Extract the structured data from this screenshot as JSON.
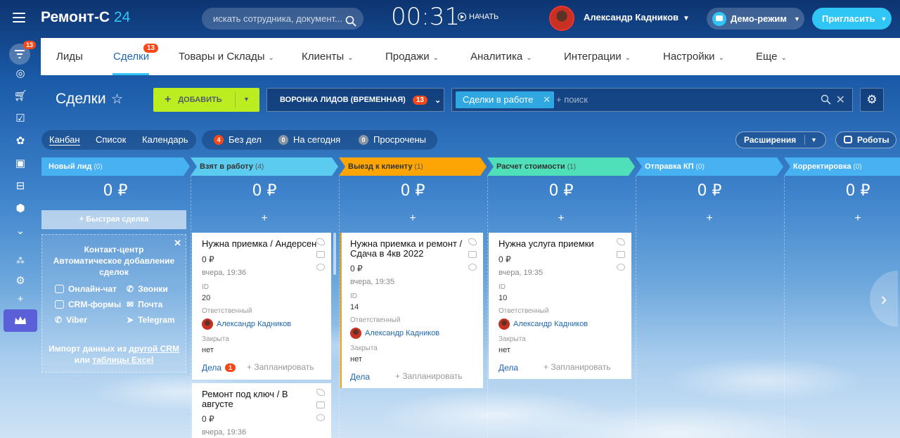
{
  "app": {
    "logo_main": "Ремонт-С",
    "logo_num": "24",
    "search_placeholder": "искать сотрудника, документ...",
    "clock": "00:31",
    "start": "НАЧАТЬ",
    "user": "Александр Кадников",
    "demo": "Демо-режим",
    "invite": "Пригласить",
    "rail_badge": "13"
  },
  "nav": {
    "items": [
      {
        "label": "Лиды",
        "dd": ""
      },
      {
        "label": "Сделки",
        "dd": ""
      },
      {
        "label": "Товары и Склады",
        "dd": "⌄"
      },
      {
        "label": "Клиенты",
        "dd": "⌄"
      },
      {
        "label": "Продажи",
        "dd": "⌄"
      },
      {
        "label": "Аналитика",
        "dd": "⌄"
      },
      {
        "label": "Интеграции",
        "dd": "⌄"
      },
      {
        "label": "Настройки",
        "dd": "⌄"
      },
      {
        "label": "Еще",
        "dd": "⌄"
      }
    ],
    "deals_badge": "13"
  },
  "toolbar": {
    "title": "Сделки",
    "add": "ДОБАВИТЬ",
    "funnel": "ВОРОНКА ЛИДОВ (ВРЕМЕННАЯ)",
    "funnel_badge": "13",
    "filter_tag": "Сделки в работе",
    "filter_placeholder": "+ поиск"
  },
  "views": {
    "kanban": "Канбан",
    "list": "Список",
    "calendar": "Календарь"
  },
  "counters": [
    {
      "n": "4",
      "label": "Без дел",
      "color": "#f54819"
    },
    {
      "n": "0",
      "label": "На сегодня",
      "color": "#7c8592"
    },
    {
      "n": "0",
      "label": "Просрочены",
      "color": "#7c8592"
    }
  ],
  "extensions": "Расширения",
  "robots": "Роботы",
  "columns": [
    {
      "name": "Новый лид",
      "count": "(0)",
      "sum": "0 ₽",
      "color": "#47b1f2"
    },
    {
      "name": "Взят в работу",
      "count": "(4)",
      "sum": "0 ₽",
      "color": "#5bcbef"
    },
    {
      "name": "Выезд к клиенту",
      "count": "(1)",
      "sum": "0 ₽",
      "color": "#fda505"
    },
    {
      "name": "Расчет стоимости",
      "count": "(1)",
      "sum": "0 ₽",
      "color": "#4fe0b9"
    },
    {
      "name": "Отправка КП",
      "count": "(0)",
      "sum": "0 ₽",
      "color": "#47b1f2"
    },
    {
      "name": "Корректировка",
      "count": "(0)",
      "sum": "0 ₽",
      "color": "#47b1f2"
    }
  ],
  "quick_deal": "Быстрая сделка",
  "contact_center": {
    "title": "Контакт-центр Автоматическое добавление сделок",
    "channels": [
      "Онлайн-чат",
      "Звонки",
      "CRM-формы",
      "Почта",
      "Viber",
      "Telegram"
    ],
    "import_prefix": "Импорт данных из",
    "import_link1": "другой CRM",
    "import_or": "или",
    "import_link2": "таблицы Excel"
  },
  "card_labels": {
    "id": "ID",
    "resp": "Ответственный",
    "closed": "Закрыта",
    "deals": "Дела",
    "plan": "+ Запланировать"
  },
  "cards": [
    {
      "title": "Нужна приемка / Андерсен",
      "sum": "0 ₽",
      "date": "вчера, 19:36",
      "id": "20",
      "resp": "Александр Кадников",
      "closed": "нет",
      "deals_badge": "1"
    },
    {
      "title": "Ремонт под ключ / В августе",
      "sum": "0 ₽",
      "date": "вчера, 19:36"
    },
    {
      "title": "Нужна приемка и ремонт / Сдача в 4кв 2022",
      "sum": "0 ₽",
      "date": "вчера, 19:35",
      "id": "14",
      "resp": "Александр Кадников",
      "closed": "нет"
    },
    {
      "title": "Нужна услуга приемки",
      "sum": "0 ₽",
      "date": "вчера, 19:35",
      "id": "10",
      "resp": "Александр Кадников",
      "closed": "нет"
    }
  ]
}
